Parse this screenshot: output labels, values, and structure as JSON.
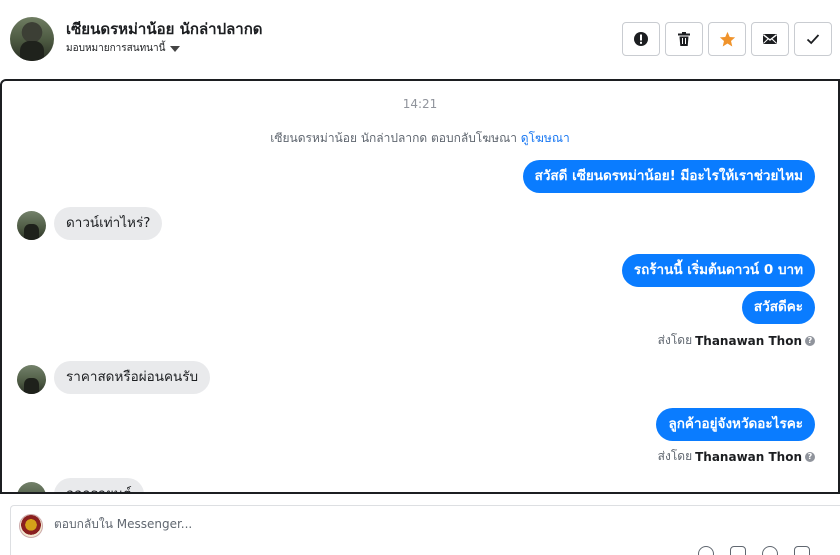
{
  "header": {
    "contact_name": "เซียนดรหม่าน้อย นักล่าปลากด",
    "assign_label": "มอบหมายการสนทนานี้",
    "actions": [
      {
        "name": "mark-spam-button",
        "icon": "exclamation-icon"
      },
      {
        "name": "delete-button",
        "icon": "trash-icon"
      },
      {
        "name": "star-button",
        "icon": "star-icon",
        "color": "#f0932b"
      },
      {
        "name": "mark-unread-button",
        "icon": "envelope-icon"
      },
      {
        "name": "mark-done-button",
        "icon": "check-icon"
      }
    ]
  },
  "chat": {
    "timestamp": "14:21",
    "system_message": "เซียนดรหม่าน้อย นักล่าปลากด ตอบกลับโฆษณา",
    "system_link": "ดูโฆษณา",
    "messages": [
      {
        "dir": "out",
        "text": "สวัสดี เซียนดรหม่าน้อย! มีอะไรให้เราช่วยไหม"
      },
      {
        "dir": "in",
        "text": "ดาวน์เท่าไหร่?"
      },
      {
        "dir": "out",
        "text": "รถร้านนี้ เริ่มต้นดาวน์ 0 บาท"
      },
      {
        "dir": "out",
        "text": "สวัสดีคะ"
      },
      {
        "dir": "in",
        "text": "ราคาสดหรือผ่อนคนรับ"
      },
      {
        "dir": "out",
        "text": "ลูกค้าอยู่จังหวัดอะไรคะ"
      },
      {
        "dir": "in",
        "text": "ออกรถยนต์"
      }
    ],
    "sent_by_prefix": "ส่งโดย",
    "sent_by_name": "Thanawan Thon",
    "help_glyph": "?"
  },
  "composer": {
    "placeholder": "ตอบกลับใน Messenger..."
  },
  "colors": {
    "accent": "#0a7cff",
    "incoming_bubble": "#e9eaec",
    "link": "#1877f2"
  }
}
